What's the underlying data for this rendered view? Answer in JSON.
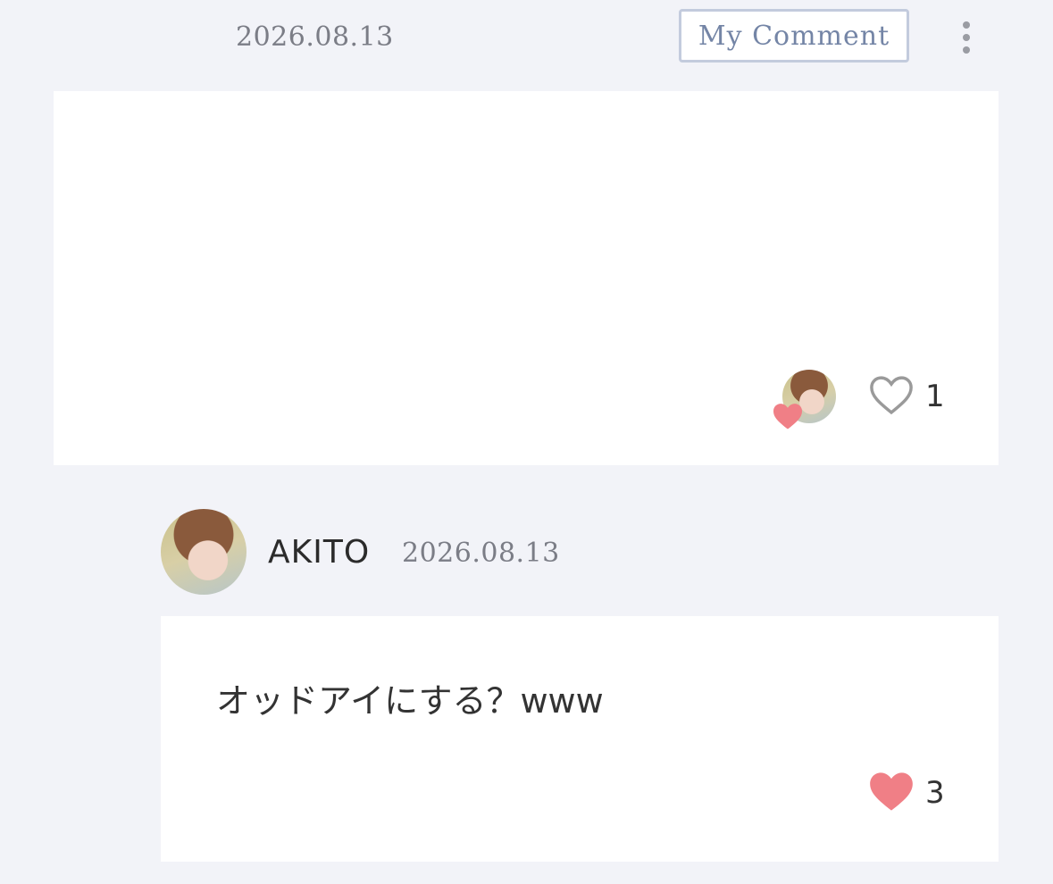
{
  "header": {
    "date": "2026.08.13",
    "my_comment_label": "My Comment",
    "more_icon": "more-vertical-icon"
  },
  "post": {
    "liked_by_icon": "heart-icon",
    "like_icon": "heart-outline-icon",
    "like_count": "1"
  },
  "comment": {
    "author": "AKITO",
    "date": "2026.08.13",
    "text": "オッドアイにする？www",
    "like_icon": "heart-filled-icon",
    "like_count": "3"
  },
  "colors": {
    "background": "#f2f3f8",
    "card": "#ffffff",
    "accent_button": "#7485a6",
    "heart": "#f07f86"
  }
}
